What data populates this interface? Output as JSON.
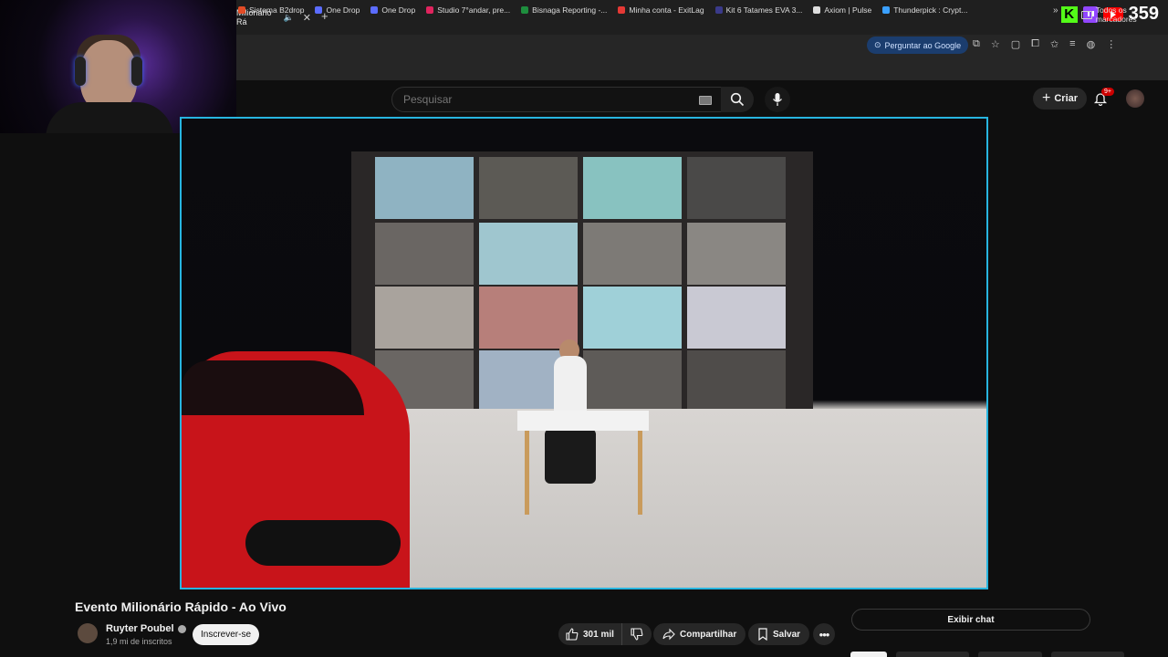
{
  "browser": {
    "tab_title": "Milionário Rá",
    "ask_google": "Perguntar ao Google",
    "bookmarks": [
      {
        "label": "Sistema B2drop",
        "color": "#e34c26"
      },
      {
        "label": "One Drop",
        "color": "#5b6cff"
      },
      {
        "label": "One Drop",
        "color": "#5b6cff"
      },
      {
        "label": "Studio 7°andar, pre...",
        "color": "#e0245e"
      },
      {
        "label": "Bisnaga Reporting -...",
        "color": "#1e8e3e"
      },
      {
        "label": "Minha conta - ExitLag",
        "color": "#e53935"
      },
      {
        "label": "Kit 6 Tatames EVA 3...",
        "color": "#3a3a8a"
      },
      {
        "label": "Axiom | Pulse",
        "color": "#dddddd"
      },
      {
        "label": "Thunderpick : Crypt...",
        "color": "#3aa0ff"
      }
    ],
    "bookmarks_folder": "Todos os marcadores"
  },
  "stream_overlay": {
    "viewer_count": "359"
  },
  "header": {
    "search_placeholder": "Pesquisar",
    "create_label": "Criar",
    "notifications_badge": "9+"
  },
  "video": {
    "title": "Evento Milionário Rápido - Ao Vivo",
    "channel": "Ruyter Poubel",
    "subscribers": "1,9 mi de inscritos",
    "subscribe_label": "Inscrever-se",
    "likes": "301 mil",
    "share_label": "Compartilhar",
    "save_label": "Salvar",
    "chat_label": "Exibir chat"
  },
  "colors": {
    "accent_border": "#27b5e0",
    "subscribe_bg": "#f1f1f1",
    "badge": "#cc0000"
  }
}
